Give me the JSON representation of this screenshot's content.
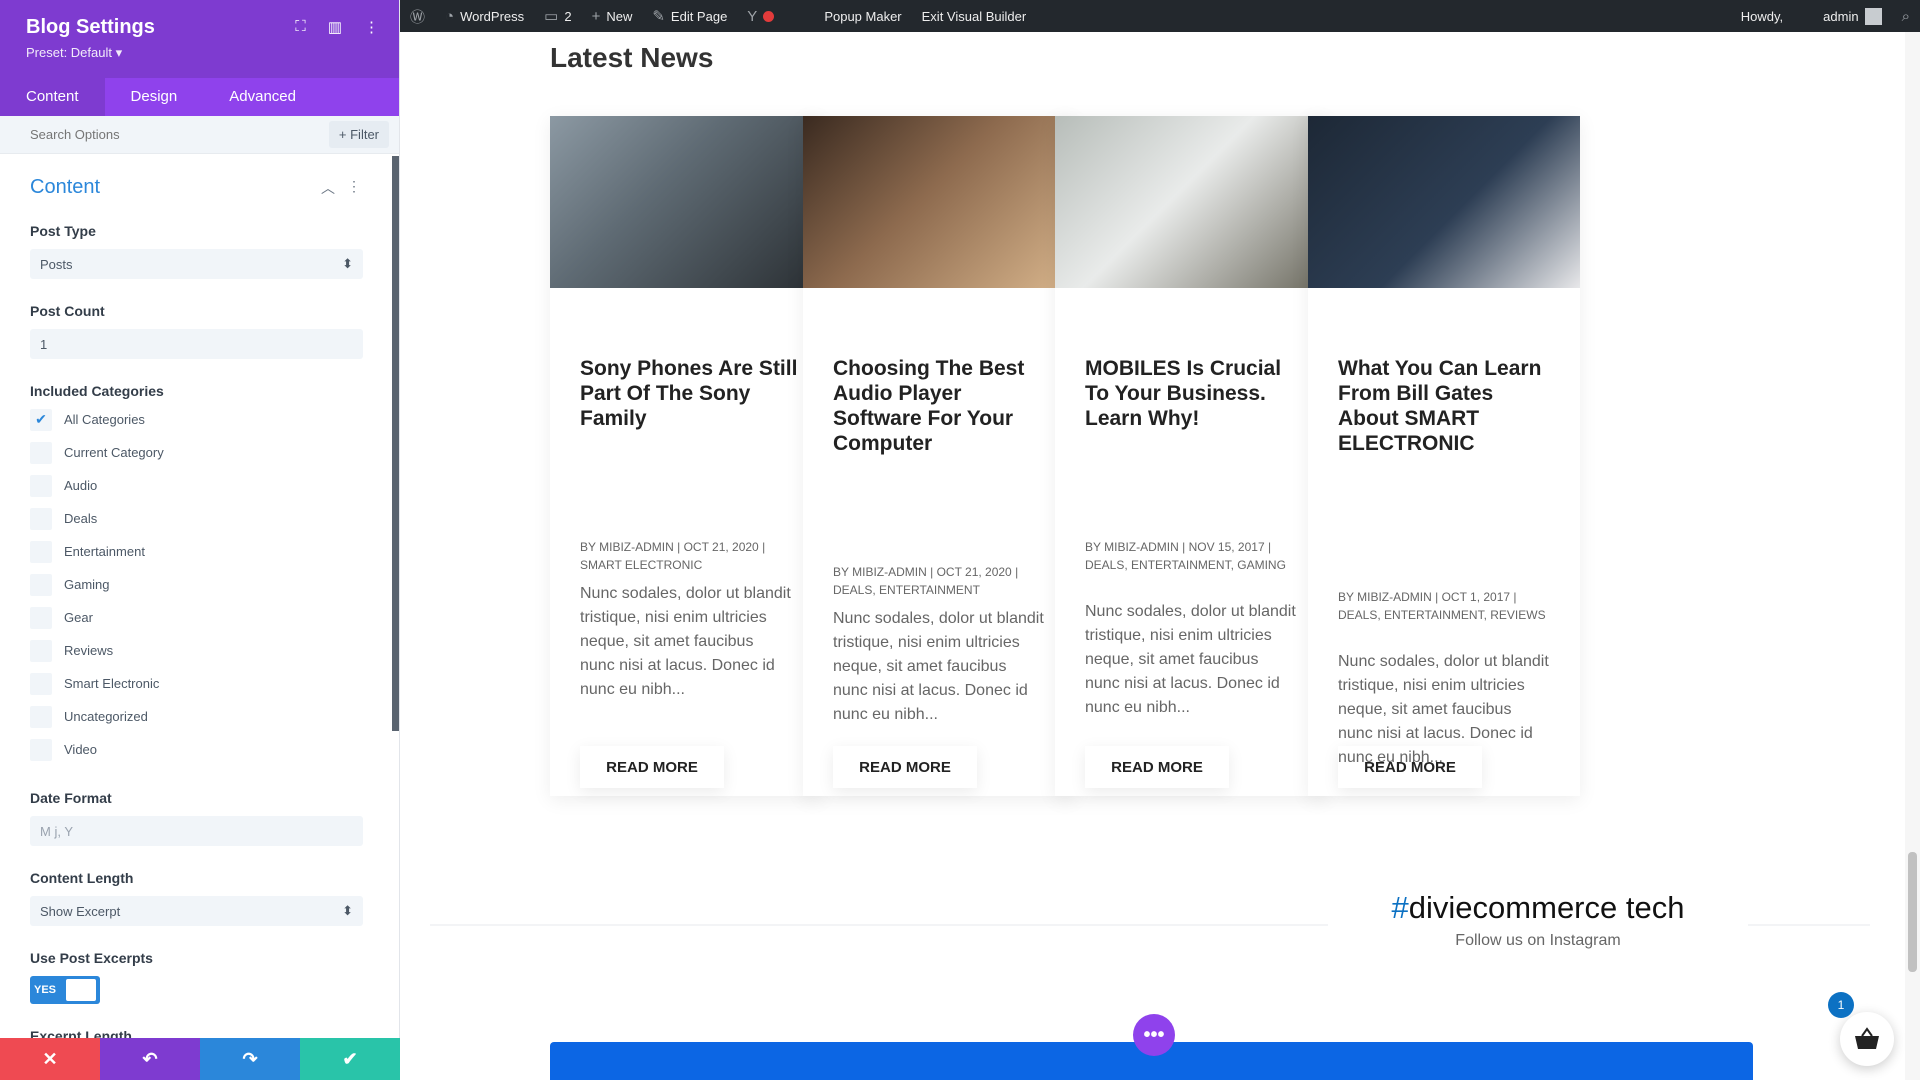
{
  "panel": {
    "title": "Blog Settings",
    "preset": "Preset: Default ▾",
    "tabs": [
      "Content",
      "Design",
      "Advanced"
    ],
    "search_placeholder": "Search Options",
    "filter_label": "+ Filter",
    "section_title": "Content",
    "post_type": {
      "label": "Post Type",
      "value": "Posts"
    },
    "post_count": {
      "label": "Post Count",
      "value": "1"
    },
    "categories": {
      "label": "Included Categories",
      "items": [
        {
          "name": "All Categories",
          "checked": true
        },
        {
          "name": "Current Category",
          "checked": false
        },
        {
          "name": "Audio",
          "checked": false
        },
        {
          "name": "Deals",
          "checked": false
        },
        {
          "name": "Entertainment",
          "checked": false
        },
        {
          "name": "Gaming",
          "checked": false
        },
        {
          "name": "Gear",
          "checked": false
        },
        {
          "name": "Reviews",
          "checked": false
        },
        {
          "name": "Smart Electronic",
          "checked": false
        },
        {
          "name": "Uncategorized",
          "checked": false
        },
        {
          "name": "Video",
          "checked": false
        }
      ]
    },
    "date_format": {
      "label": "Date Format",
      "placeholder": "M j, Y"
    },
    "content_length": {
      "label": "Content Length",
      "value": "Show Excerpt"
    },
    "use_excerpts": {
      "label": "Use Post Excerpts",
      "toggle": "YES"
    },
    "excerpt_length_label": "Excerpt Length",
    "footer_colors": [
      "#ef4a52",
      "#7e3bd0",
      "#2b87da",
      "#29c4a9"
    ]
  },
  "adminbar": {
    "site": "WordPress",
    "comments": "2",
    "new": "New",
    "edit_page": "Edit Page",
    "popup_maker": "Popup Maker",
    "exit_builder": "Exit Visual Builder",
    "howdy": "Howdy,",
    "user": "admin"
  },
  "page": {
    "heading": "Latest News",
    "posts": [
      {
        "title": "Sony Phones Are Still Part Of The Sony Family",
        "meta": "BY MIBIZ-ADMIN | OCT 21, 2020 | SMART ELECTRONIC",
        "excerpt": "Nunc sodales, dolor ut blandit tristique, nisi enim ultricies neque, sit amet faucibus nunc nisi at lacus. Donec id nunc eu nibh...",
        "button": "READ MORE"
      },
      {
        "title": "Choosing The Best Audio Player Software For Your Computer",
        "meta": "BY MIBIZ-ADMIN | OCT 21, 2020 | DEALS, ENTERTAINMENT",
        "excerpt": "Nunc sodales, dolor ut blandit tristique, nisi enim ultricies neque, sit amet faucibus nunc nisi at lacus. Donec id nunc eu nibh...",
        "button": "READ MORE"
      },
      {
        "title": "MOBILES Is Crucial To Your Business. Learn Why!",
        "meta": "BY MIBIZ-ADMIN | NOV 15, 2017 | DEALS, ENTERTAINMENT, GAMING",
        "excerpt": "Nunc sodales, dolor ut blandit tristique, nisi enim ultricies neque, sit amet faucibus nunc nisi at lacus. Donec id nunc eu nibh...",
        "button": "READ MORE"
      },
      {
        "title": "What You Can Learn From Bill Gates About SMART ELECTRONIC",
        "meta": "BY MIBIZ-ADMIN | OCT 1, 2017 | DEALS, ENTERTAINMENT, REVIEWS",
        "excerpt": "Nunc sodales, dolor ut blandit tristique, nisi enim ultricies neque, sit amet faucibus nunc nisi at lacus. Donec id nunc eu nibh...",
        "button": "READ MORE"
      }
    ],
    "hashtag_symbol": "#",
    "hashtag_text": "diviecommerce tech",
    "follow": "Follow us on Instagram",
    "cart_count": "1"
  }
}
